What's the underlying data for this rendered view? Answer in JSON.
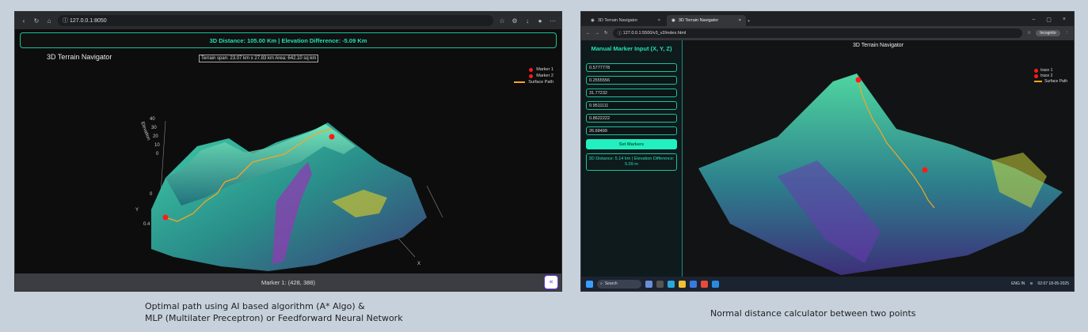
{
  "left": {
    "url": "127.0.0.1:8050",
    "banner": "3D Distance: 105.00 Km | Elevation Difference: -5.09 Km",
    "plot_title": "3D Terrain Navigator",
    "terrain_span": "Terrain span: 23.07 km x 27.83 km  Area: 642.10 sq km",
    "legend": {
      "marker1": "Marker 1",
      "marker2": "Marker 2",
      "path": "Surface Path"
    },
    "axis": {
      "z_label": "Elevation",
      "z_ticks": [
        "40",
        "30",
        "20",
        "10",
        "0"
      ],
      "y_label": "Y",
      "y_tick_a": "0",
      "y_tick_b": "0.4",
      "x_label": "X"
    },
    "status": "Marker 1: (428, 388)",
    "path_color": "#f5a623",
    "marker_color": "#ff1a1a"
  },
  "right": {
    "tab1": "3D Terrain Navigator",
    "tab2": "3D Terrain Navigator",
    "url": "127.0.0.1:5500/v3_v2/index.html",
    "incognito": "Incognito",
    "sidebar_title": "Manual Marker Input (X, Y, Z)",
    "inputs": [
      "0.5777778",
      "0.2555556",
      "31.77232",
      "0.9511111",
      "0.8622222",
      "26.68499"
    ],
    "button": "Set Markers",
    "result": "3D Distance: 5.14 km | Elevation Difference: 5.09 m",
    "plot_title": "3D Terrain Navigator",
    "legend": {
      "trace1": "trace 1",
      "trace2": "trace 2",
      "path": "Surface Path"
    },
    "taskbar": {
      "search": "Search",
      "lang": "ENG",
      "region": "IN",
      "time": "02:07",
      "date": "18-05-2025"
    }
  },
  "captions": {
    "left_line1": "Optimal path using AI based algorithm (A* Algo) &",
    "left_line2": "MLP (Multilater Preceptron) or Feedforward Neural Network",
    "right": "Normal distance calculator between two points"
  }
}
